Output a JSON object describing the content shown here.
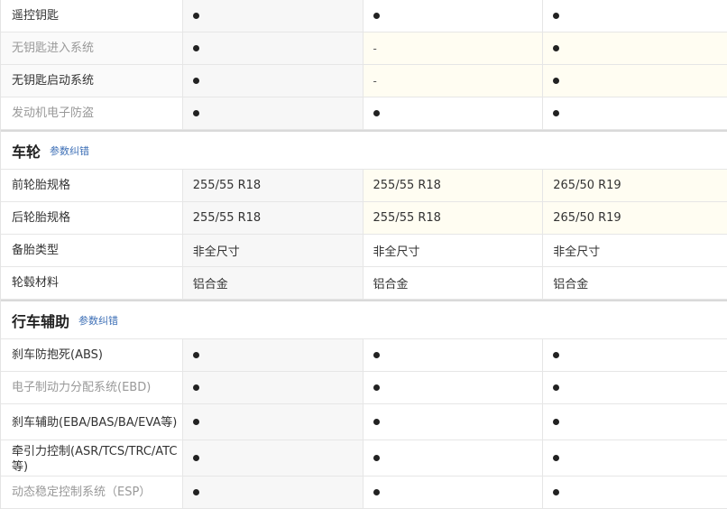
{
  "sections": [
    {
      "rows": [
        {
          "label": "遥控钥匙",
          "grey": false,
          "values": [
            "dot",
            "dot",
            "dot"
          ]
        },
        {
          "label": "无钥匙进入系统",
          "grey": true,
          "values": [
            "dot",
            "-",
            "dot"
          ]
        },
        {
          "label": "无钥匙启动系统",
          "grey": false,
          "values": [
            "dot",
            "-",
            "dot"
          ]
        },
        {
          "label": "发动机电子防盗",
          "grey": true,
          "values": [
            "dot",
            "dot",
            "dot"
          ]
        }
      ]
    },
    {
      "title": "车轮",
      "link": "参数纠错",
      "rows": [
        {
          "label": "前轮胎规格",
          "values": [
            "255/55 R18",
            "255/55 R18",
            "265/50 R19"
          ]
        },
        {
          "label": "后轮胎规格",
          "values": [
            "255/55 R18",
            "255/55 R18",
            "265/50 R19"
          ]
        },
        {
          "label": "备胎类型",
          "values": [
            "非全尺寸",
            "非全尺寸",
            "非全尺寸"
          ]
        },
        {
          "label": "轮毂材料",
          "values": [
            "铝合金",
            "铝合金",
            "铝合金"
          ]
        }
      ]
    },
    {
      "title": "行车辅助",
      "link": "参数纠错",
      "rows": [
        {
          "label": "刹车防抱死(ABS)",
          "values": [
            "dot",
            "dot",
            "dot"
          ]
        },
        {
          "label": "电子制动力分配系统(EBD)",
          "grey": true,
          "values": [
            "dot",
            "dot",
            "dot"
          ]
        },
        {
          "label": "刹车辅助(EBA/BAS/BA/EVA等)",
          "values": [
            "dot",
            "dot",
            "dot"
          ]
        },
        {
          "label": "牵引力控制(ASR/TCS/TRC/ATC等)",
          "values": [
            "dot",
            "dot",
            "dot"
          ]
        },
        {
          "label": "动态稳定控制系统（ESP）",
          "grey": true,
          "values": [
            "dot",
            "dot",
            "dot"
          ]
        }
      ]
    }
  ]
}
